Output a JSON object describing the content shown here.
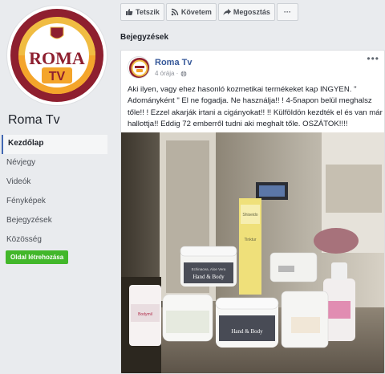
{
  "page": {
    "name": "Roma Tv",
    "logo_text_main": "ROMA",
    "logo_text_sub": "TV"
  },
  "nav": [
    {
      "label": "Kezdőlap",
      "active": true
    },
    {
      "label": "Névjegy"
    },
    {
      "label": "Videók"
    },
    {
      "label": "Fényképek"
    },
    {
      "label": "Bejegyzések"
    },
    {
      "label": "Közösség"
    }
  ],
  "create_page_label": "Oldal létrehozása",
  "actions": {
    "like": "Tetszik",
    "follow": "Követem",
    "share": "Megosztás",
    "more": "···"
  },
  "section_title": "Bejegyzések",
  "post": {
    "author": "Roma Tv",
    "time": "4 órája · ",
    "more": "•••",
    "text": "Aki ilyen, vagy ehez hasonló kozmetikai termékeket kap INGYEN. \" Adományként \" El ne fogadja. Ne használja!! ! 4-5napon belül meghalsz tőle!! ! Ezzel akarják irtani a cigányokat!! !! Külföldön kezdték el és van már hallottja!! Eddig 72 emberről tudni aki meghalt tőle. OSZÁTOK!!!!"
  },
  "photo_labels": {
    "jar_main": "Hand & Body",
    "jar_main_sub": "Echinacea, Aloe Vera",
    "jar_bottom": "Hand & Body",
    "tube": "Shiseido",
    "tube_sub": "Tinktur",
    "bottle": "Bodymil"
  },
  "colors": {
    "facebook_blue": "#365899",
    "green_button": "#42b72a",
    "roma_red": "#8e1f2f",
    "roma_gold": "#f0bc42"
  }
}
